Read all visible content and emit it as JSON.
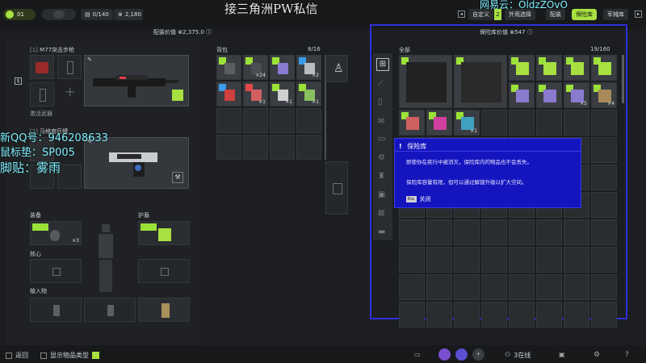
{
  "topbar": {
    "level": "01",
    "capacity": "0/140",
    "currency": "2,180",
    "stream_title": "接三角洲PW私信",
    "watermark_right": "网易云：OldzZOvO",
    "tabs": [
      "自定义",
      "外观选择",
      "配装",
      "保险库",
      "军械库"
    ],
    "tab_count": "2",
    "active_tab": "保险库"
  },
  "loadout": {
    "value_label": "配装价值",
    "value": "2,375.0",
    "primary_slot": "[1]",
    "primary_name": "M77突击步枪",
    "activate_label": "激活武器",
    "secondary_slot": "[2]",
    "secondary_name": "马格南巨蟒",
    "equip_label": "装备",
    "equip_count": "×3",
    "armor_label": "护盾",
    "core_label": "核心",
    "implant_label": "植入物"
  },
  "backpack": {
    "label": "背包",
    "capacity": "8/16",
    "counts": [
      "×24",
      "×2",
      "×1",
      "×1",
      "×1"
    ]
  },
  "vault": {
    "value_label": "保险库价值",
    "value": "547",
    "filter": "全部",
    "capacity": "19/160",
    "counts": [
      "×5",
      "×4",
      "×1"
    ]
  },
  "popup": {
    "title": "保险库",
    "line1": "即使你在疾行中被消灭，保险库内的物品也不会丢失。",
    "line2": "保险库容量有限，但可以通过解锁升级以扩大空间。",
    "close_key": "Esc",
    "close_label": "关闭"
  },
  "overlay": {
    "qq": "新QQ号：946208633",
    "mouse": "鼠标垫：SP005",
    "script": "脚贴：雾雨"
  },
  "bottombar": {
    "back_label": "返回",
    "show_type_label": "显示物品类型",
    "online": "3在线",
    "help": "?"
  },
  "colors": {
    "accent_green": "#a7e040",
    "popup_blue": "#1515c0",
    "highlight_border": "#2f2fd8"
  }
}
